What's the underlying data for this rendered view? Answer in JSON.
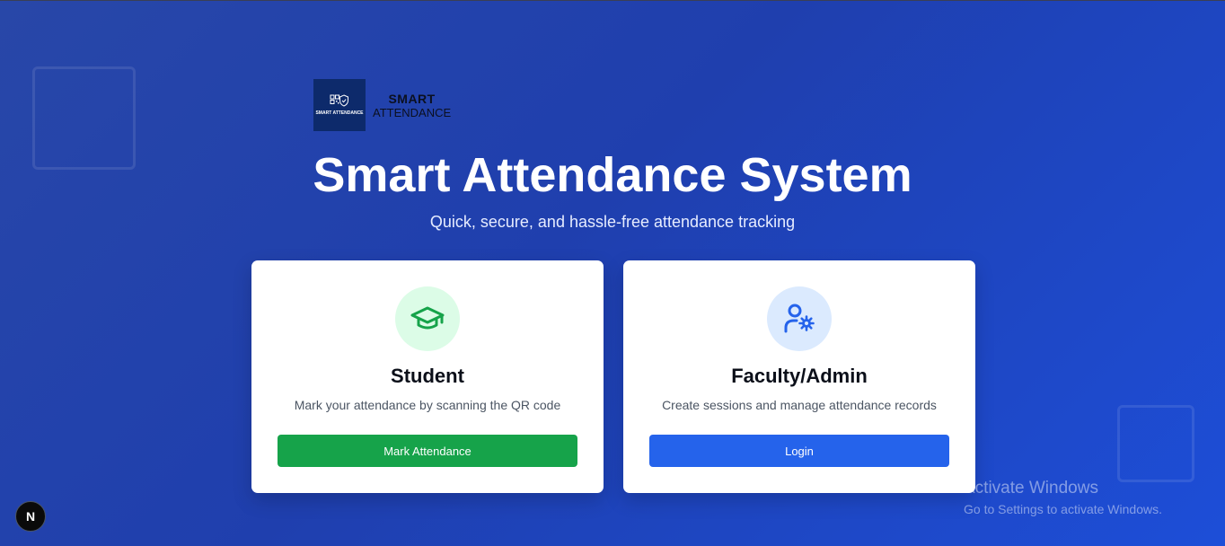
{
  "brand": {
    "logo_text": "SMART ATTENDANCE",
    "line1": "SMART",
    "line2": "ATTENDANCE"
  },
  "hero": {
    "title": "Smart Attendance System",
    "subtitle": "Quick, secure, and hassle-free attendance tracking"
  },
  "cards": [
    {
      "title": "Student",
      "description": "Mark your attendance by scanning the QR code",
      "button_label": "Mark Attendance",
      "icon": "graduation-cap-icon",
      "accent": "#16a34a",
      "icon_bg": "#dcfce7"
    },
    {
      "title": "Faculty/Admin",
      "description": "Create sessions and manage attendance records",
      "button_label": "Login",
      "icon": "user-gear-icon",
      "accent": "#2563eb",
      "icon_bg": "#dbeafe"
    }
  ],
  "dev_badge": {
    "label": "N"
  },
  "watermark": {
    "line1": "Activate Windows",
    "line2": "Go to Settings to activate Windows."
  }
}
